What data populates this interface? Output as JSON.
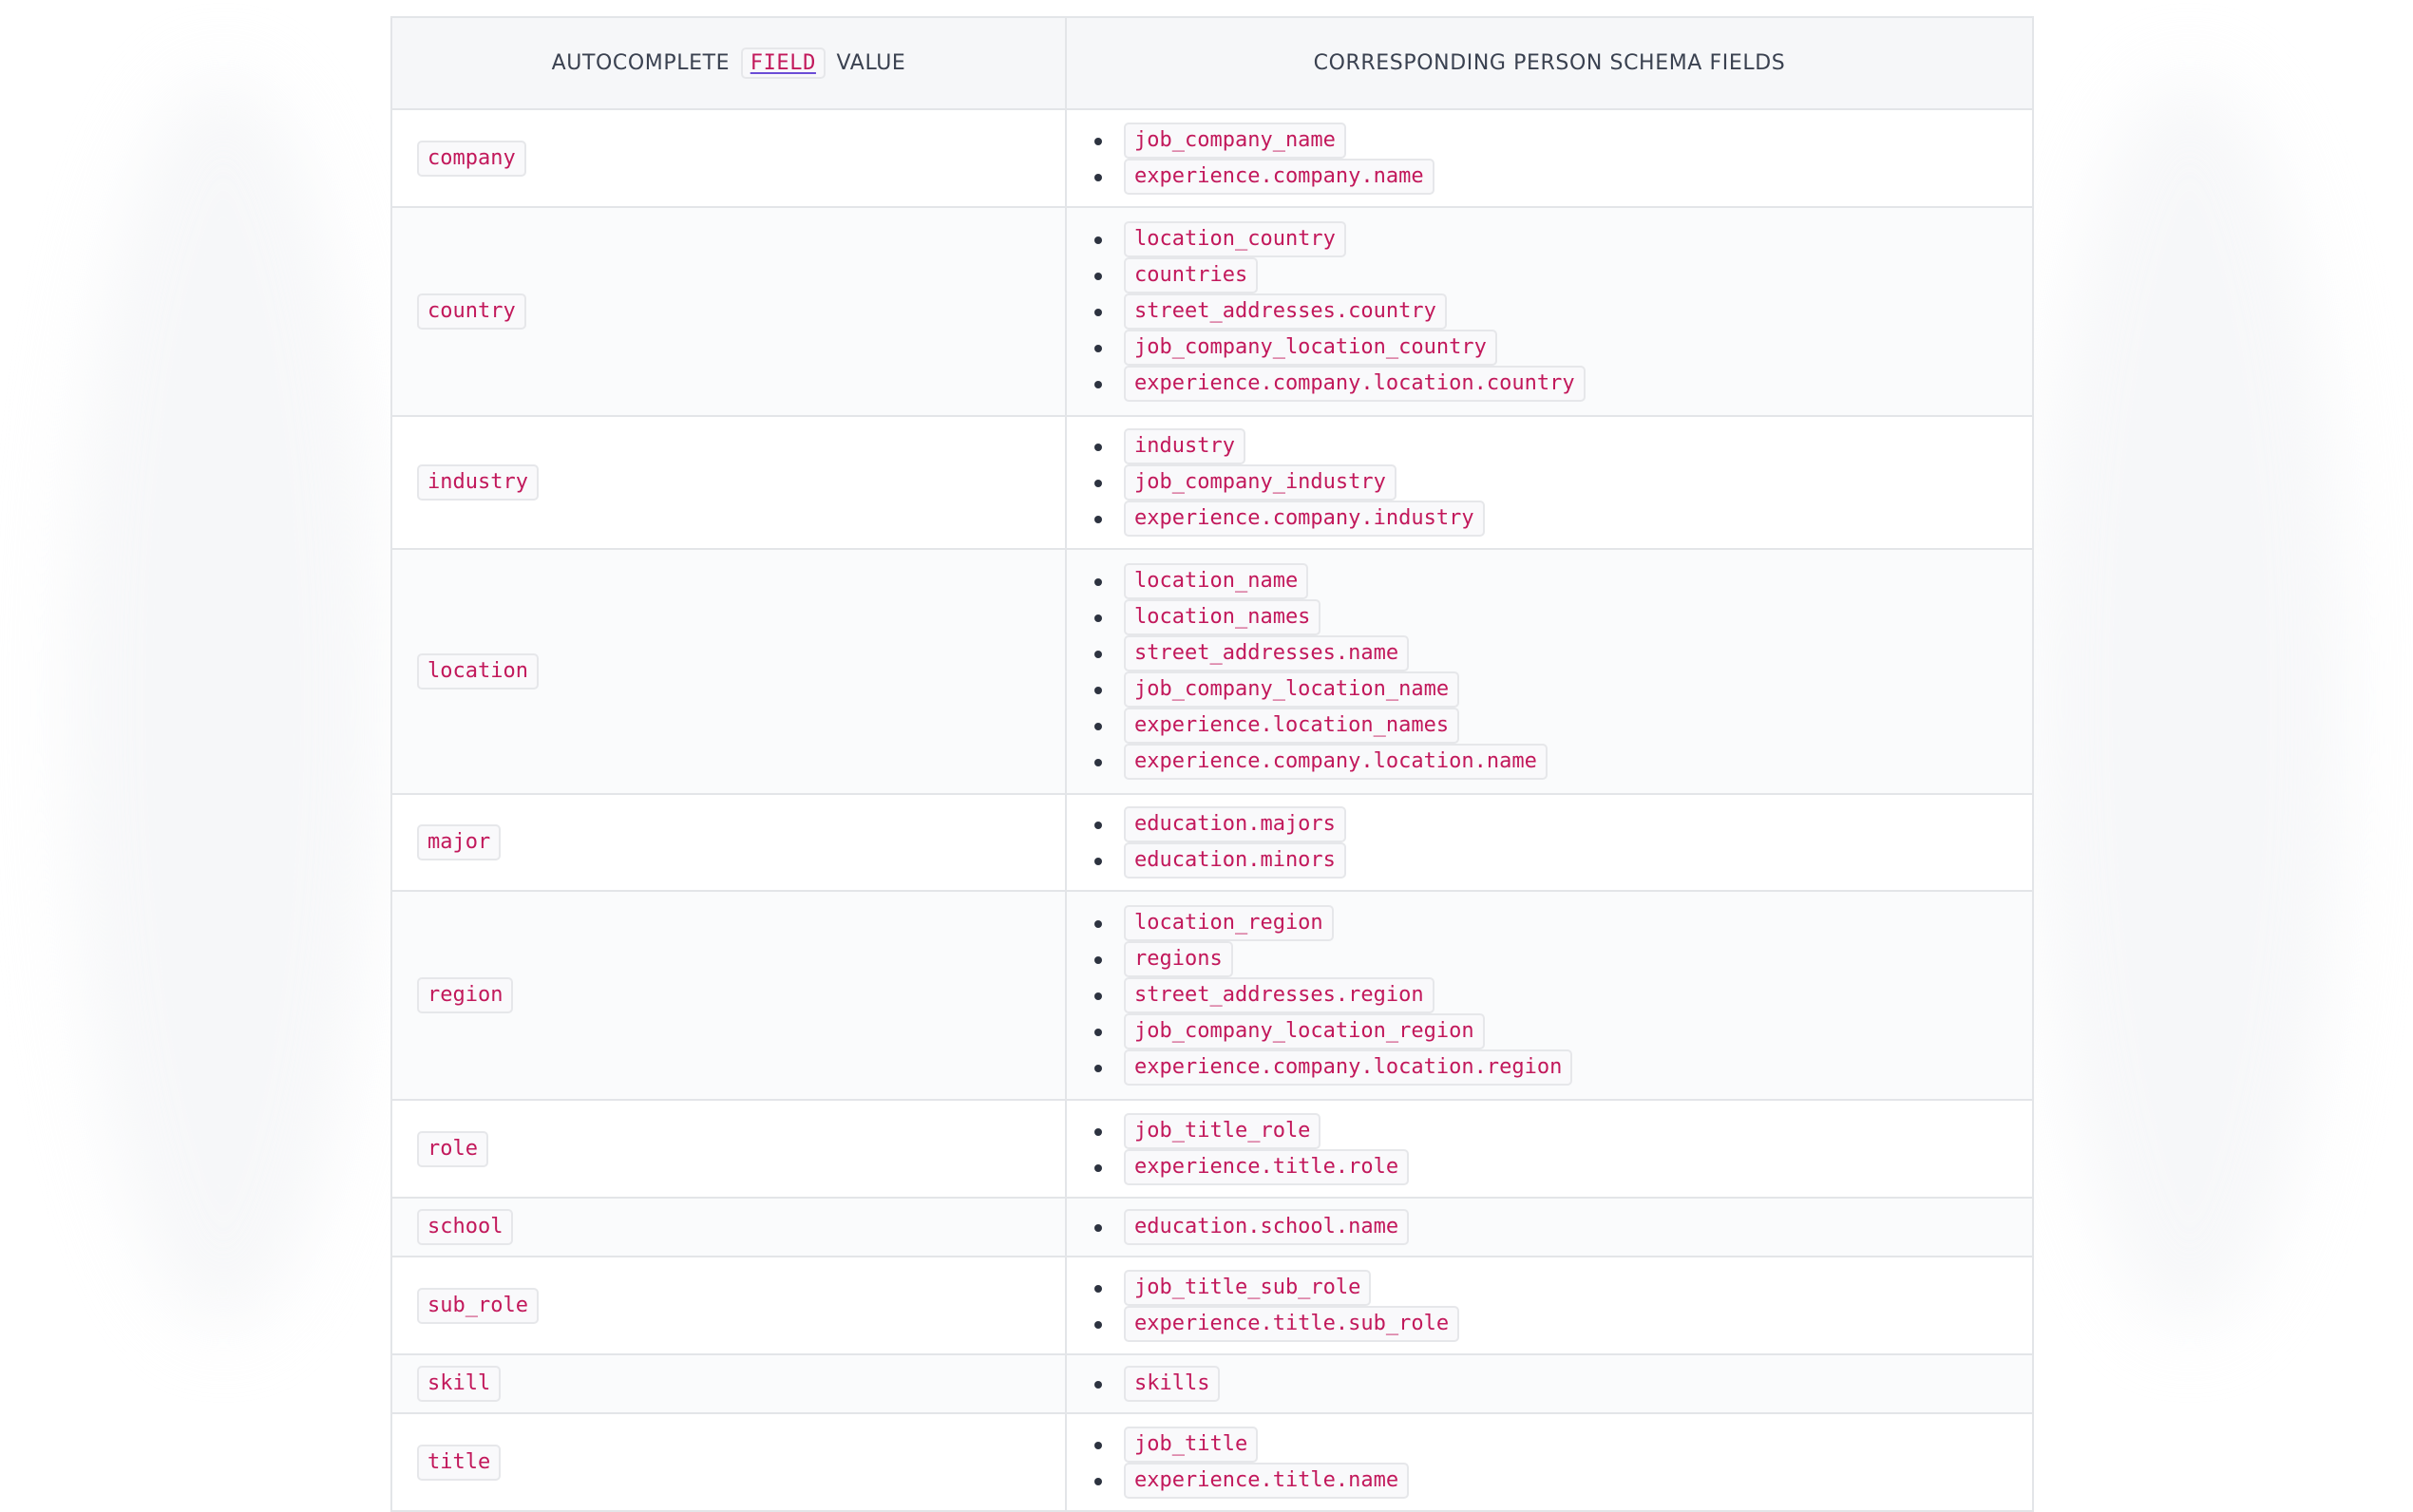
{
  "table": {
    "header": {
      "col1_prefix": "AUTOCOMPLETE",
      "col1_code": "FIELD",
      "col1_suffix": "VALUE",
      "col2": "CORRESPONDING PERSON SCHEMA FIELDS"
    },
    "rows": [
      {
        "value": "company",
        "fields": [
          "job_company_name",
          "experience.company.name"
        ]
      },
      {
        "value": "country",
        "fields": [
          "location_country",
          "countries",
          "street_addresses.country",
          "job_company_location_country",
          "experience.company.location.country"
        ]
      },
      {
        "value": "industry",
        "fields": [
          "industry",
          "job_company_industry",
          "experience.company.industry"
        ]
      },
      {
        "value": "location",
        "fields": [
          "location_name",
          "location_names",
          "street_addresses.name",
          "job_company_location_name",
          "experience.location_names",
          "experience.company.location.name"
        ]
      },
      {
        "value": "major",
        "fields": [
          "education.majors",
          "education.minors"
        ]
      },
      {
        "value": "region",
        "fields": [
          "location_region",
          "regions",
          "street_addresses.region",
          "job_company_location_region",
          "experience.company.location.region"
        ]
      },
      {
        "value": "role",
        "fields": [
          "job_title_role",
          "experience.title.role"
        ]
      },
      {
        "value": "school",
        "fields": [
          "education.school.name"
        ]
      },
      {
        "value": "sub_role",
        "fields": [
          "job_title_sub_role",
          "experience.title.sub_role"
        ]
      },
      {
        "value": "skill",
        "fields": [
          "skills"
        ]
      },
      {
        "value": "title",
        "fields": [
          "job_title",
          "experience.title.name"
        ]
      }
    ]
  }
}
